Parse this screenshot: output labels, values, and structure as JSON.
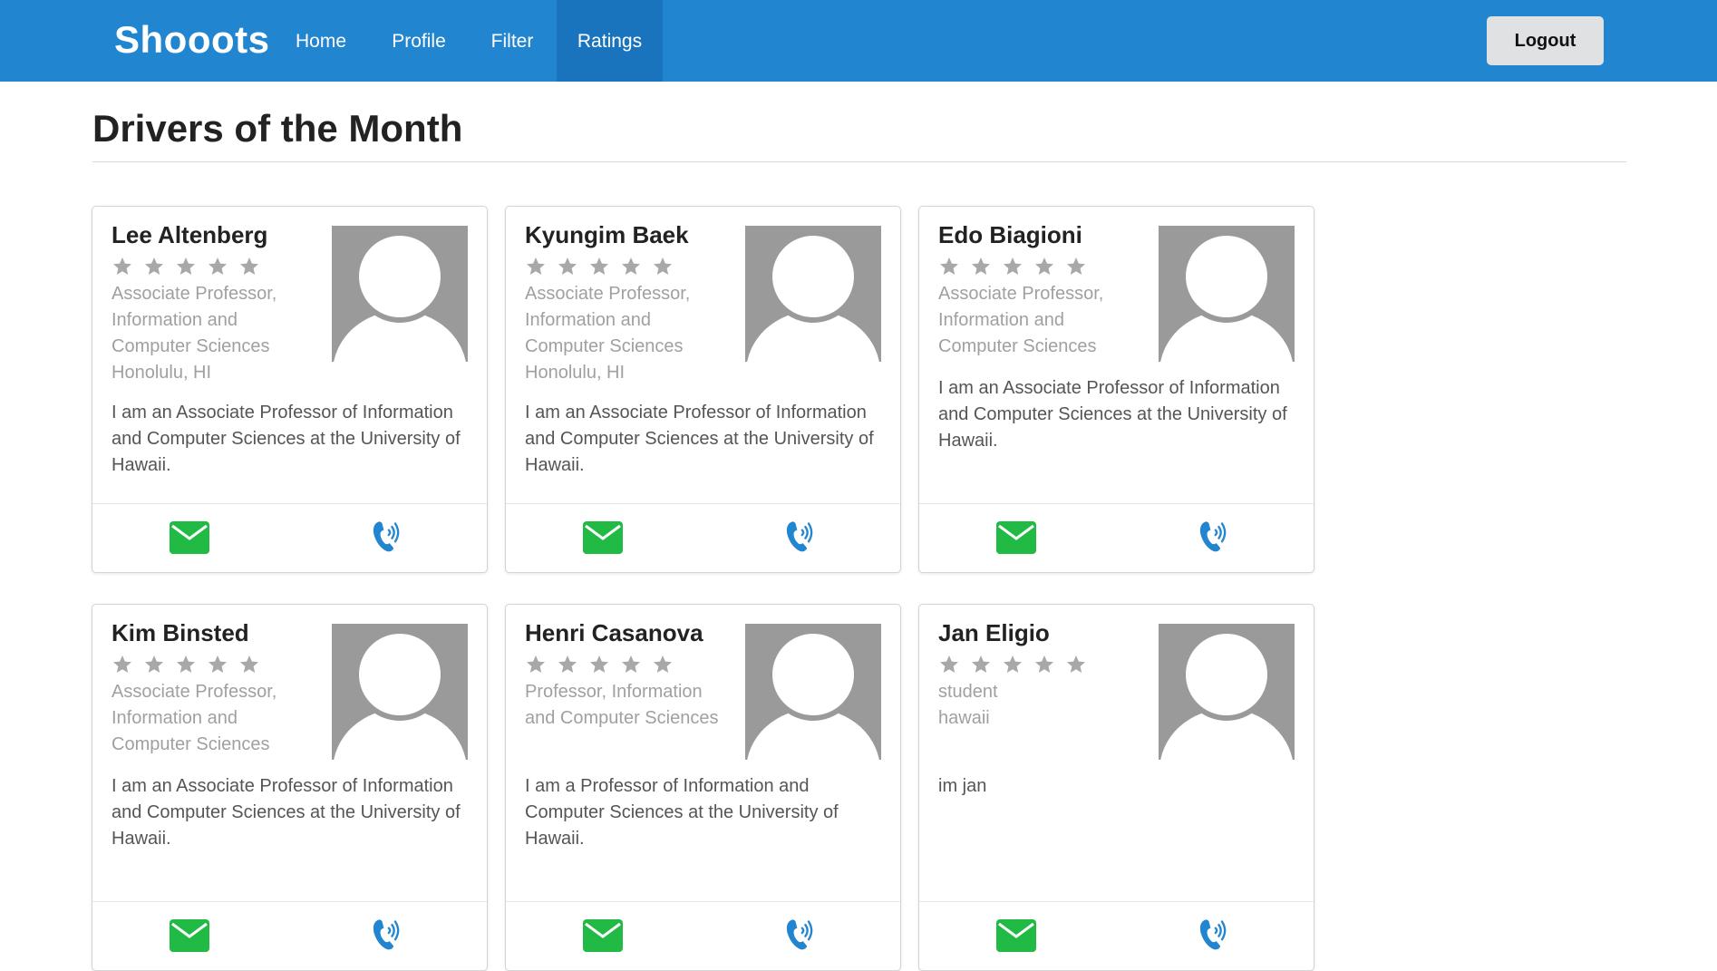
{
  "navbar": {
    "brand": "Shooots",
    "items": [
      {
        "label": "Home",
        "active": false
      },
      {
        "label": "Profile",
        "active": false
      },
      {
        "label": "Filter",
        "active": false
      },
      {
        "label": "Ratings",
        "active": true
      }
    ],
    "logout_label": "Logout"
  },
  "page": {
    "title": "Drivers of the Month"
  },
  "colors": {
    "navbar": "#2185d0",
    "nav_active": "#1a74bd",
    "star": "#a8a8a8",
    "email_icon": "#21ba45",
    "phone_icon": "#2185d0",
    "avatar_bg": "#9a9a9a"
  },
  "icons": {
    "star": "star-icon",
    "email": "envelope-icon",
    "phone": "phone-volume-icon",
    "avatar": "user-avatar-icon"
  },
  "drivers": [
    {
      "name": "Lee Altenberg",
      "rating": 0,
      "title": "Associate Professor, Information and Computer Sciences",
      "location": "Honolulu, HI",
      "description": "I am an Associate Professor of Information and Computer Sciences at the University of Hawaii."
    },
    {
      "name": "Kyungim Baek",
      "rating": 0,
      "title": "Associate Professor, Information and Computer Sciences",
      "location": "Honolulu, HI",
      "description": "I am an Associate Professor of Information and Computer Sciences at the University of Hawaii."
    },
    {
      "name": "Edo Biagioni",
      "rating": 0,
      "title": "Associate Professor, Information and Computer Sciences",
      "location": "",
      "description": "I am an Associate Professor of Information and Computer Sciences at the University of Hawaii."
    },
    {
      "name": "Kim Binsted",
      "rating": 0,
      "title": "Associate Professor, Information and Computer Sciences",
      "location": "",
      "description": "I am an Associate Professor of Information and Computer Sciences at the University of Hawaii."
    },
    {
      "name": "Henri Casanova",
      "rating": 0,
      "title": "Professor, Information and Computer Sciences",
      "location": "",
      "description": "I am a Professor of Information and Computer Sciences at the University of Hawaii."
    },
    {
      "name": "Jan Eligio",
      "rating": 0,
      "title": "student",
      "location": "hawaii",
      "description": "im jan"
    }
  ]
}
